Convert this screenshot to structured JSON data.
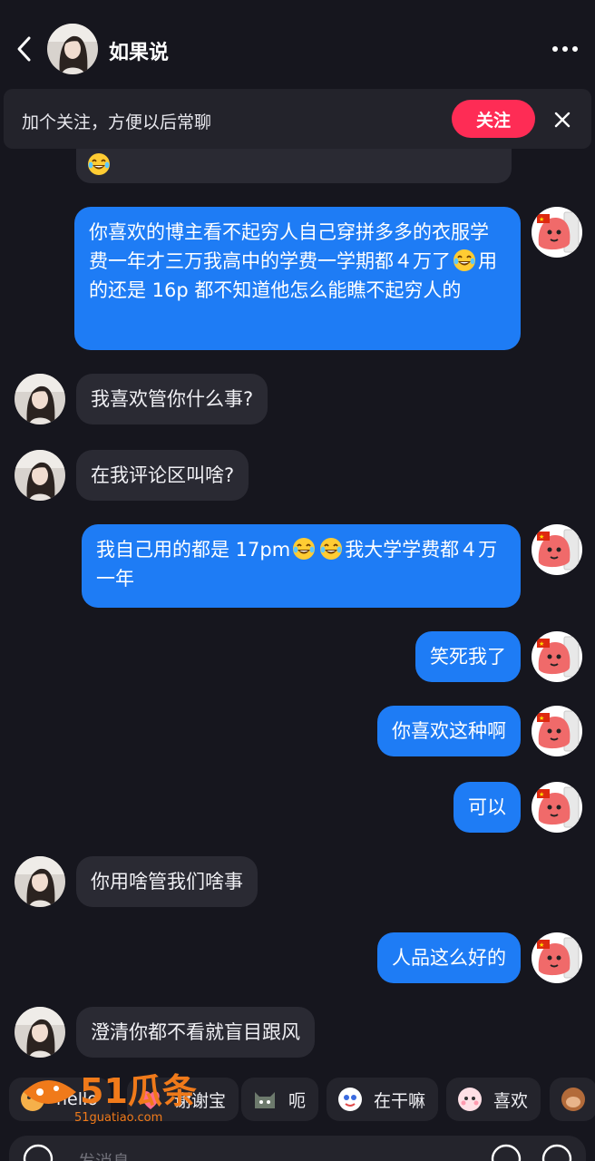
{
  "header": {
    "title": "如果说"
  },
  "follow_banner": {
    "text": "加个关注，方便以后常聊",
    "button_label": "关注"
  },
  "messages": [
    {
      "from": "me",
      "segments": [
        "你喜欢的博主看不起穷人自己穿拼多多的衣服学费一年才三万我高中的学费一学期都４万了",
        "用的还是 16p 都不知道他怎么能瞧不起穷人的"
      ]
    },
    {
      "from": "them",
      "text": "我喜欢管你什么事?"
    },
    {
      "from": "them",
      "text": "在我评论区叫啥?"
    },
    {
      "from": "me",
      "segments": [
        "我自己用的都是 17pm",
        "我大学学费都４万一年"
      ]
    },
    {
      "from": "me",
      "text": "笑死我了"
    },
    {
      "from": "me",
      "text": "你喜欢这种啊"
    },
    {
      "from": "me",
      "text": "可以"
    },
    {
      "from": "them",
      "text": "你用啥管我们啥事"
    },
    {
      "from": "me",
      "text": "人品这么好的"
    },
    {
      "from": "them",
      "text": "澄清你都不看就盲目跟风"
    }
  ],
  "quick_replies": [
    "hello",
    "谢谢宝",
    "呃",
    "在干嘛",
    "喜欢"
  ],
  "watermark": {
    "brand": "51瓜条",
    "url": "51guatiao.com"
  },
  "input": {
    "placeholder": "发消息..."
  },
  "icons": {
    "back": "chevron-left-icon",
    "more": "more-dots-icon",
    "close": "close-icon",
    "laugh": "laughing-emoji-icon"
  },
  "colors": {
    "background": "#16161e",
    "my_bubble": "#1e7cf5",
    "their_bubble": "#2a2a33",
    "follow_button": "#fe2c55"
  }
}
